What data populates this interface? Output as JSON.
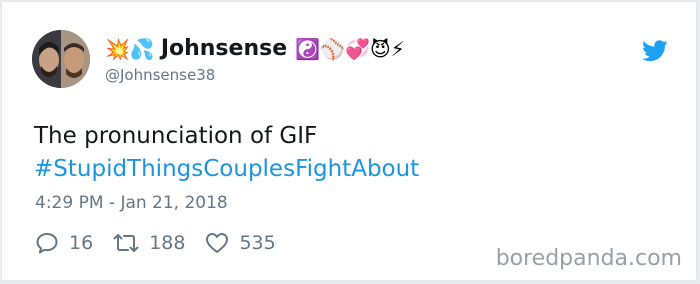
{
  "tweet": {
    "author": {
      "name_prefix_emoji": "💥💦",
      "name": "Johnsense",
      "name_suffix_emoji": "☯️⚾💞😈⚡",
      "handle": "@Johnsense38"
    },
    "text": "The pronunciation of GIF",
    "hashtag": "#StupidThingsCouplesFightAbout",
    "timestamp": "4:29 PM - Jan 21, 2018",
    "stats": {
      "replies": "16",
      "retweets": "188",
      "likes": "535"
    },
    "colors": {
      "accent": "#1b95e0",
      "muted": "#657786",
      "text": "#14171a"
    }
  },
  "watermark": "boredpanda.com"
}
